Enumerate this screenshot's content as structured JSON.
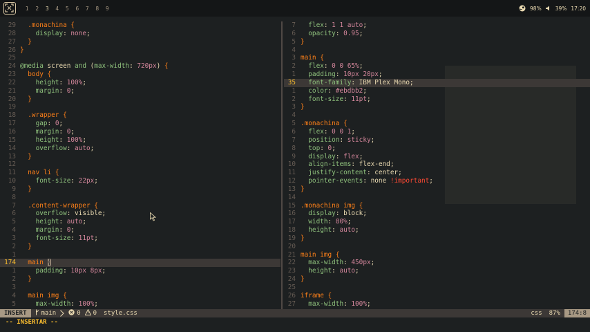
{
  "topbar": {
    "workspaces": [
      "1",
      "2",
      "3",
      "4",
      "5",
      "6",
      "7",
      "8",
      "9"
    ],
    "active_workspace": "3",
    "steam_status": "98%",
    "volume": "39%",
    "clock": "17:20"
  },
  "left_pane": [
    {
      "n": "29",
      "c": [
        [
          "sel",
          "  .monachina "
        ],
        [
          "brace",
          "{"
        ]
      ]
    },
    {
      "n": "28",
      "c": [
        [
          "prop",
          "    display"
        ],
        [
          "def",
          ": "
        ],
        [
          "val",
          "none"
        ],
        [
          "def",
          ";"
        ]
      ]
    },
    {
      "n": "27",
      "c": [
        [
          "brace",
          "  }"
        ]
      ]
    },
    {
      "n": "26",
      "c": [
        [
          "brace",
          "}"
        ]
      ]
    },
    {
      "n": "25",
      "c": []
    },
    {
      "n": "24",
      "c": [
        [
          "at",
          "@media "
        ],
        [
          "def",
          "screen "
        ],
        [
          "kw",
          "and "
        ],
        [
          "def",
          "("
        ],
        [
          "prop",
          "max-width"
        ],
        [
          "def",
          ": "
        ],
        [
          "val",
          "720px"
        ],
        [
          "def",
          ") "
        ],
        [
          "brace",
          "{"
        ]
      ]
    },
    {
      "n": "23",
      "c": [
        [
          "sel",
          "  body "
        ],
        [
          "brace",
          "{"
        ]
      ]
    },
    {
      "n": "22",
      "c": [
        [
          "prop",
          "    height"
        ],
        [
          "def",
          ": "
        ],
        [
          "val",
          "100%"
        ],
        [
          "def",
          ";"
        ]
      ]
    },
    {
      "n": "21",
      "c": [
        [
          "prop",
          "    margin"
        ],
        [
          "def",
          ": "
        ],
        [
          "val",
          "0"
        ],
        [
          "def",
          ";"
        ]
      ]
    },
    {
      "n": "20",
      "c": [
        [
          "brace",
          "  }"
        ]
      ]
    },
    {
      "n": "19",
      "c": []
    },
    {
      "n": "18",
      "c": [
        [
          "sel",
          "  .wrapper "
        ],
        [
          "brace",
          "{"
        ]
      ]
    },
    {
      "n": "17",
      "c": [
        [
          "prop",
          "    gap"
        ],
        [
          "def",
          ": "
        ],
        [
          "val",
          "0"
        ],
        [
          "def",
          ";"
        ]
      ]
    },
    {
      "n": "16",
      "c": [
        [
          "prop",
          "    margin"
        ],
        [
          "def",
          ": "
        ],
        [
          "val",
          "0"
        ],
        [
          "def",
          ";"
        ]
      ]
    },
    {
      "n": "15",
      "c": [
        [
          "prop",
          "    height"
        ],
        [
          "def",
          ": "
        ],
        [
          "val",
          "100%"
        ],
        [
          "def",
          ";"
        ]
      ]
    },
    {
      "n": "14",
      "c": [
        [
          "prop",
          "    overflow"
        ],
        [
          "def",
          ": "
        ],
        [
          "val",
          "auto"
        ],
        [
          "def",
          ";"
        ]
      ]
    },
    {
      "n": "13",
      "c": [
        [
          "brace",
          "  }"
        ]
      ]
    },
    {
      "n": "12",
      "c": []
    },
    {
      "n": "11",
      "c": [
        [
          "sel",
          "  nav li "
        ],
        [
          "brace",
          "{"
        ]
      ]
    },
    {
      "n": "10",
      "c": [
        [
          "prop",
          "    font-size"
        ],
        [
          "def",
          ": "
        ],
        [
          "val",
          "22px"
        ],
        [
          "def",
          ";"
        ]
      ]
    },
    {
      "n": "9",
      "c": [
        [
          "brace",
          "  }"
        ]
      ]
    },
    {
      "n": "8",
      "c": []
    },
    {
      "n": "7",
      "c": [
        [
          "sel",
          "  .content-wrapper "
        ],
        [
          "brace",
          "{"
        ]
      ]
    },
    {
      "n": "6",
      "c": [
        [
          "prop",
          "    overflow"
        ],
        [
          "def",
          ": "
        ],
        [
          "def",
          "visible"
        ],
        [
          "def",
          ";"
        ]
      ]
    },
    {
      "n": "5",
      "c": [
        [
          "prop",
          "    height"
        ],
        [
          "def",
          ": "
        ],
        [
          "val",
          "auto"
        ],
        [
          "def",
          ";"
        ]
      ]
    },
    {
      "n": "4",
      "c": [
        [
          "prop",
          "    margin"
        ],
        [
          "def",
          ": "
        ],
        [
          "val",
          "0"
        ],
        [
          "def",
          ";"
        ]
      ]
    },
    {
      "n": "3",
      "c": [
        [
          "prop",
          "    font-size"
        ],
        [
          "def",
          ": "
        ],
        [
          "val",
          "11pt"
        ],
        [
          "def",
          ";"
        ]
      ]
    },
    {
      "n": "2",
      "c": [
        [
          "brace",
          "  }"
        ]
      ]
    },
    {
      "n": "1",
      "c": []
    },
    {
      "n": "174",
      "cur": true,
      "c": [
        [
          "sel",
          "  main "
        ],
        [
          "cursor",
          "{"
        ]
      ]
    },
    {
      "n": "1",
      "c": [
        [
          "prop",
          "    padding"
        ],
        [
          "def",
          ": "
        ],
        [
          "val",
          "10px 8px"
        ],
        [
          "def",
          ";"
        ]
      ]
    },
    {
      "n": "2",
      "c": [
        [
          "brace",
          "  }"
        ]
      ]
    },
    {
      "n": "3",
      "c": []
    },
    {
      "n": "4",
      "c": [
        [
          "sel",
          "  main img "
        ],
        [
          "brace",
          "{"
        ]
      ]
    },
    {
      "n": "5",
      "c": [
        [
          "prop",
          "    max-width"
        ],
        [
          "def",
          ": "
        ],
        [
          "val",
          "100%"
        ],
        [
          "def",
          ";"
        ]
      ]
    }
  ],
  "right_pane": [
    {
      "n": "7",
      "c": [
        [
          "prop",
          "  flex"
        ],
        [
          "def",
          ": "
        ],
        [
          "val",
          "1 1 auto"
        ],
        [
          "def",
          ";"
        ]
      ]
    },
    {
      "n": "6",
      "c": [
        [
          "prop",
          "  opacity"
        ],
        [
          "def",
          ": "
        ],
        [
          "val",
          "0.95"
        ],
        [
          "def",
          ";"
        ]
      ]
    },
    {
      "n": "5",
      "c": [
        [
          "brace",
          "}"
        ]
      ]
    },
    {
      "n": "4",
      "c": []
    },
    {
      "n": "3",
      "c": [
        [
          "sel",
          "main "
        ],
        [
          "brace",
          "{"
        ]
      ]
    },
    {
      "n": "2",
      "c": [
        [
          "prop",
          "  flex"
        ],
        [
          "def",
          ": "
        ],
        [
          "val",
          "0 0 65%"
        ],
        [
          "def",
          ";"
        ]
      ]
    },
    {
      "n": "1",
      "c": [
        [
          "prop",
          "  padding"
        ],
        [
          "def",
          ": "
        ],
        [
          "val",
          "10px 20px"
        ],
        [
          "def",
          ";"
        ]
      ]
    },
    {
      "n": "35",
      "cur": true,
      "c": [
        [
          "prop",
          "  font-family"
        ],
        [
          "def",
          ": IBM Plex Mono;"
        ]
      ]
    },
    {
      "n": "1",
      "c": [
        [
          "prop",
          "  color"
        ],
        [
          "def",
          ": "
        ],
        [
          "val",
          "#ebdbb2"
        ],
        [
          "def",
          ";"
        ]
      ]
    },
    {
      "n": "2",
      "c": [
        [
          "prop",
          "  font-size"
        ],
        [
          "def",
          ": "
        ],
        [
          "val",
          "11pt"
        ],
        [
          "def",
          ";"
        ]
      ]
    },
    {
      "n": "3",
      "c": [
        [
          "brace",
          "}"
        ]
      ]
    },
    {
      "n": "4",
      "c": []
    },
    {
      "n": "5",
      "c": [
        [
          "sel",
          ".monachina "
        ],
        [
          "brace",
          "{"
        ]
      ]
    },
    {
      "n": "6",
      "c": [
        [
          "prop",
          "  flex"
        ],
        [
          "def",
          ": "
        ],
        [
          "val",
          "0 0 1"
        ],
        [
          "def",
          ";"
        ]
      ]
    },
    {
      "n": "7",
      "c": [
        [
          "prop",
          "  position"
        ],
        [
          "def",
          ": "
        ],
        [
          "val",
          "sticky"
        ],
        [
          "def",
          ";"
        ]
      ]
    },
    {
      "n": "8",
      "c": [
        [
          "prop",
          "  top"
        ],
        [
          "def",
          ": "
        ],
        [
          "val",
          "0"
        ],
        [
          "def",
          ";"
        ]
      ]
    },
    {
      "n": "9",
      "c": [
        [
          "prop",
          "  display"
        ],
        [
          "def",
          ": "
        ],
        [
          "val",
          "flex"
        ],
        [
          "def",
          ";"
        ]
      ]
    },
    {
      "n": "10",
      "c": [
        [
          "prop",
          "  align-items"
        ],
        [
          "def",
          ": "
        ],
        [
          "def",
          "flex-end"
        ],
        [
          "def",
          ";"
        ]
      ]
    },
    {
      "n": "11",
      "c": [
        [
          "prop",
          "  justify-content"
        ],
        [
          "def",
          ": "
        ],
        [
          "def",
          "center"
        ],
        [
          "def",
          ";"
        ]
      ]
    },
    {
      "n": "12",
      "c": [
        [
          "prop",
          "  pointer-events"
        ],
        [
          "def",
          ": "
        ],
        [
          "def",
          "none "
        ],
        [
          "imp",
          "!important"
        ],
        [
          "def",
          ";"
        ]
      ]
    },
    {
      "n": "13",
      "c": [
        [
          "brace",
          "}"
        ]
      ]
    },
    {
      "n": "14",
      "c": []
    },
    {
      "n": "15",
      "c": [
        [
          "sel",
          ".monachina img "
        ],
        [
          "brace",
          "{"
        ]
      ]
    },
    {
      "n": "16",
      "c": [
        [
          "prop",
          "  display"
        ],
        [
          "def",
          ": "
        ],
        [
          "def",
          "block"
        ],
        [
          "def",
          ";"
        ]
      ]
    },
    {
      "n": "17",
      "c": [
        [
          "prop",
          "  width"
        ],
        [
          "def",
          ": "
        ],
        [
          "val",
          "80%"
        ],
        [
          "def",
          ";"
        ]
      ]
    },
    {
      "n": "18",
      "c": [
        [
          "prop",
          "  height"
        ],
        [
          "def",
          ": "
        ],
        [
          "val",
          "auto"
        ],
        [
          "def",
          ";"
        ]
      ]
    },
    {
      "n": "19",
      "c": [
        [
          "brace",
          "}"
        ]
      ]
    },
    {
      "n": "20",
      "c": []
    },
    {
      "n": "21",
      "c": [
        [
          "sel",
          "main img "
        ],
        [
          "brace",
          "{"
        ]
      ]
    },
    {
      "n": "22",
      "c": [
        [
          "prop",
          "  max-width"
        ],
        [
          "def",
          ": "
        ],
        [
          "val",
          "450px"
        ],
        [
          "def",
          ";"
        ]
      ]
    },
    {
      "n": "23",
      "c": [
        [
          "prop",
          "  height"
        ],
        [
          "def",
          ": "
        ],
        [
          "val",
          "auto"
        ],
        [
          "def",
          ";"
        ]
      ]
    },
    {
      "n": "24",
      "c": [
        [
          "brace",
          "}"
        ]
      ]
    },
    {
      "n": "25",
      "c": []
    },
    {
      "n": "26",
      "c": [
        [
          "sel",
          "iframe "
        ],
        [
          "brace",
          "{"
        ]
      ]
    },
    {
      "n": "27",
      "c": [
        [
          "prop",
          "  max-width"
        ],
        [
          "def",
          ": "
        ],
        [
          "val",
          "100%"
        ],
        [
          "def",
          ";"
        ]
      ]
    }
  ],
  "statusline": {
    "mode": "INSERT",
    "branch": "main",
    "errors": "0",
    "warnings": "0",
    "filename": "style.css",
    "filetype": "css",
    "percent": "87%",
    "position": "174:8"
  },
  "cmdline": "-- INSERTAR --",
  "colors": {
    "bg": "#1d2021",
    "fg": "#ebdbb2",
    "orange": "#fe8019",
    "aqua": "#8ec07c",
    "purple": "#d3869b",
    "yellow": "#fabd2f",
    "red": "#fb4934"
  }
}
